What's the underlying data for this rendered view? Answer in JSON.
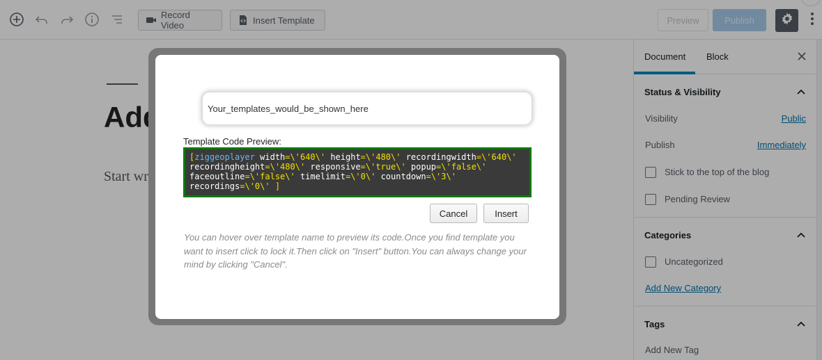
{
  "toolbar": {
    "record_video": "Record Video",
    "insert_template": "Insert Template",
    "preview": "Preview",
    "publish": "Publish"
  },
  "editor": {
    "title": "Add title",
    "placeholder": "Start writing or type / to choose a block"
  },
  "sidebar": {
    "tabs": [
      "Document",
      "Block"
    ],
    "status_visibility": {
      "title": "Status & Visibility",
      "visibility_label": "Visibility",
      "visibility_value": "Public",
      "publish_label": "Publish",
      "publish_value": "Immediately",
      "stick_label": "Stick to the top of the blog",
      "pending_label": "Pending Review"
    },
    "categories": {
      "title": "Categories",
      "items": [
        "Uncategorized"
      ],
      "add_new": "Add New Category"
    },
    "tags": {
      "title": "Tags",
      "add_new_label": "Add New Tag"
    }
  },
  "modal": {
    "template_name": "Your_templates_would_be_shown_here",
    "code_label": "Template Code Preview:",
    "code_lines": [
      "[ziggeoplayer width=\\'640\\' height=\\'480\\' recordingwidth=\\'640\\'",
      "recordingheight=\\'480\\' responsive=\\'true\\' popup=\\'false\\'",
      "faceoutline=\\'false\\' timelimit=\\'0\\' countdown=\\'3\\'",
      "recordings=\\'0\\' ]"
    ],
    "cancel": "Cancel",
    "insert": "Insert",
    "help_text": "You can hover over template name to preview its code.Once you find template you want to insert click to lock it.Then click on \"Insert\" button.You can always change your mind by clicking \"Cancel\"."
  },
  "colors": {
    "accent": "#0085ba",
    "code_border": "#0b7a0b",
    "code_bg": "#3a3a3a",
    "code_keyword": "#6cb4e8",
    "code_string": "#f0e000"
  }
}
